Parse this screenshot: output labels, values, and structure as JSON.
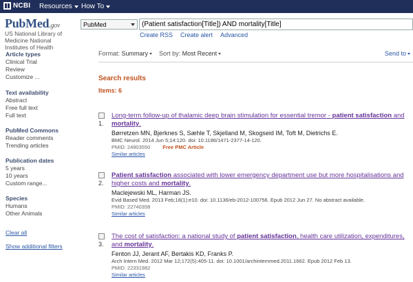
{
  "topbar": {
    "ncbi": "NCBI",
    "resources": "Resources",
    "howto": "How To"
  },
  "header": {
    "logo_pub": "Pub",
    "logo_med": "Med",
    "logo_gov": ".gov",
    "db": "PubMed",
    "query": "(Patient satisfaction[Title]) AND mortality[Title]",
    "create_rss": "Create RSS",
    "create_alert": "Create alert",
    "advanced": "Advanced"
  },
  "sidebar": {
    "lib_line1": "US National Library of",
    "lib_line2": "Medicine National",
    "lib_line3": "Institutes of Health",
    "groups": [
      {
        "title": "Article types",
        "items": [
          "Clinical Trial",
          "Review",
          "Customize ..."
        ]
      },
      {
        "title": "Text availability",
        "items": [
          "Abstract",
          "Free full text",
          "Full text"
        ]
      },
      {
        "title": "PubMed Commons",
        "items": [
          "Reader comments",
          "Trending articles"
        ]
      },
      {
        "title": "Publication dates",
        "items": [
          "5 years",
          "10 years",
          "Custom range..."
        ]
      },
      {
        "title": "Species",
        "items": [
          "Humans",
          "Other Animals"
        ]
      }
    ],
    "clear_all": "Clear all",
    "show_filters": "Show additional filters"
  },
  "main": {
    "format_label": "Format:",
    "format_value": "Summary",
    "sort_label": "Sort by:",
    "sort_value": "Most Recent",
    "send_to": "Send to",
    "results_title": "Search results",
    "items": "Items: 6"
  },
  "results": [
    {
      "num": "1.",
      "title_pre": "Long-term follow-up of thalamic deep brain stimulation for essential tremor - ",
      "title_b1": "patient satisfaction",
      "title_mid": " and ",
      "title_b2": "mortality",
      "title_post": ".",
      "authors": "Børretzen MN, Bjerknes S, Sæhle T, Skjelland M, Skogseid IM, Toft M, Dietrichs E.",
      "cite": "BMC Neurol. 2014 Jun 5;14:120. doi: 10.1186/1471-2377-14-120.",
      "pmid": "PMID: 24903550",
      "pmc": "Free PMC Article",
      "similar": "Similar articles"
    },
    {
      "num": "2.",
      "title_pre": "",
      "title_b1": "Patient satisfaction",
      "title_mid": " associated with lower emergency department use but more hospitalisations and higher costs and ",
      "title_b2": "mortality",
      "title_post": ".",
      "authors": "Maclejewski ML, Harman JS.",
      "cite": "Evid Based Med. 2013 Feb;18(1):e10. doi: 10.1136/eb-2012-100756. Epub 2012 Jun 27. No abstract available.",
      "pmid": "PMID: 22740358",
      "pmc": "",
      "similar": "Similar articles"
    },
    {
      "num": "3.",
      "title_pre": "The cost of satisfaction: a national study of ",
      "title_b1": "patient satisfaction",
      "title_mid": ", health care utilization, expenditures, and ",
      "title_b2": "mortality",
      "title_post": ".",
      "authors": "Fenton JJ, Jerant AF, Bertakis KD, Franks P.",
      "cite": "Arch Intern Med. 2012 Mar 12;172(5):405-11. doi: 10.1001/archinternmed.2011.1662. Epub 2012 Feb 13.",
      "pmid": "PMID: 22331982",
      "pmc": "",
      "similar": "Similar articles"
    }
  ]
}
